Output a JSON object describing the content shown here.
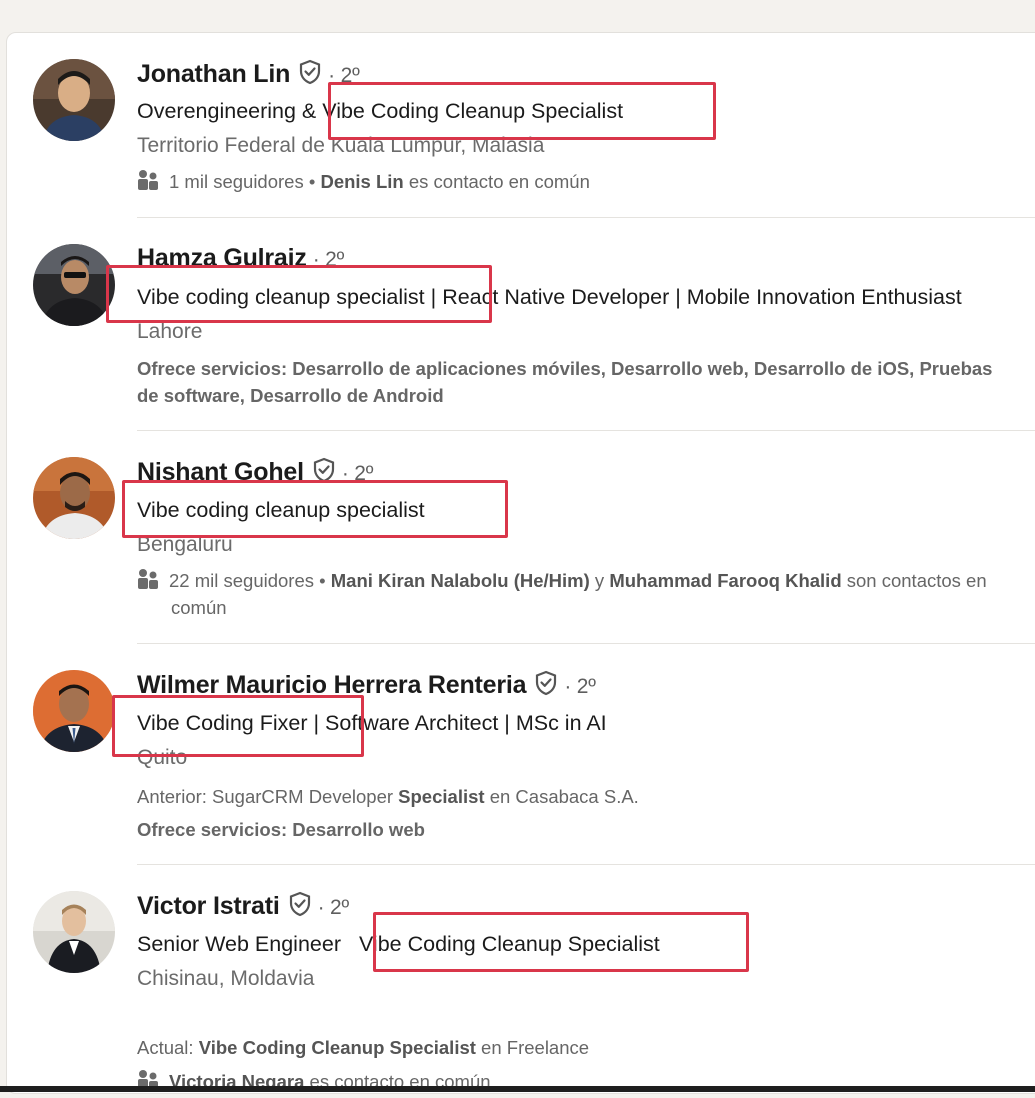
{
  "results": [
    {
      "name": "Jonathan Lin",
      "verified": true,
      "degree": "· 2º",
      "headline": "Overengineering & Vibe Coding Cleanup Specialist",
      "location": "Territorio Federal de Kuala Lumpur, Malasia",
      "followers": "1 mil seguidores",
      "sep": " • ",
      "mutual_name": "Denis Lin",
      "mutual_suffix": " es contacto en común"
    },
    {
      "name": "Hamza Gulraiz",
      "verified": false,
      "degree": "· 2º",
      "headline": "Vibe coding cleanup specialist | React Native Developer | Mobile Innovation Enthusiast",
      "location": "Lahore",
      "services_line1": "Ofrece servicios: Desarrollo de aplicaciones móviles, Desarrollo web, Desarrollo de iOS, Pruebas",
      "services_line2": "de software, Desarrollo de Android"
    },
    {
      "name": "Nishant Gohel",
      "verified": true,
      "degree": "· 2º",
      "headline": "Vibe coding cleanup specialist",
      "location": "Bengaluru",
      "followers": "22 mil seguidores",
      "sep": " • ",
      "mutual_name_1": "Mani Kiran Nalabolu (He/Him)",
      "mutual_join": " y ",
      "mutual_name_2": "Muhammad Farooq Khalid",
      "mutual_suffix": " son contactos en",
      "mutual_line2": "común"
    },
    {
      "name": "Wilmer Mauricio Herrera Renteria",
      "verified": true,
      "degree": "· 2º",
      "headline": "Vibe Coding Fixer | Software Architect | MSc in AI",
      "location": "Quito",
      "past_prefix": "Anterior: SugarCRM Developer ",
      "past_bold": "Specialist",
      "past_suffix": " en Casabaca S.A.",
      "services": "Ofrece servicios: Desarrollo web"
    },
    {
      "name": "Victor Istrati",
      "verified": true,
      "degree": "· 2º",
      "headline_part1": "Senior Web Engineer",
      "headline_part2": "Vibe Coding Cleanup Specialist",
      "location": "Chisinau, Moldavia",
      "current_prefix": "Actual: ",
      "current_bold": "Vibe Coding Cleanup Specialist",
      "current_suffix": " en Freelance",
      "mutual_name": "Victoria Negara",
      "mutual_suffix": " es contacto en común"
    }
  ],
  "icons": {
    "verified": "shield-check-icon",
    "mutual": "people-icon"
  },
  "colors": {
    "highlight": "#d9364a",
    "text": "#1b1b1b",
    "muted": "#666666"
  }
}
